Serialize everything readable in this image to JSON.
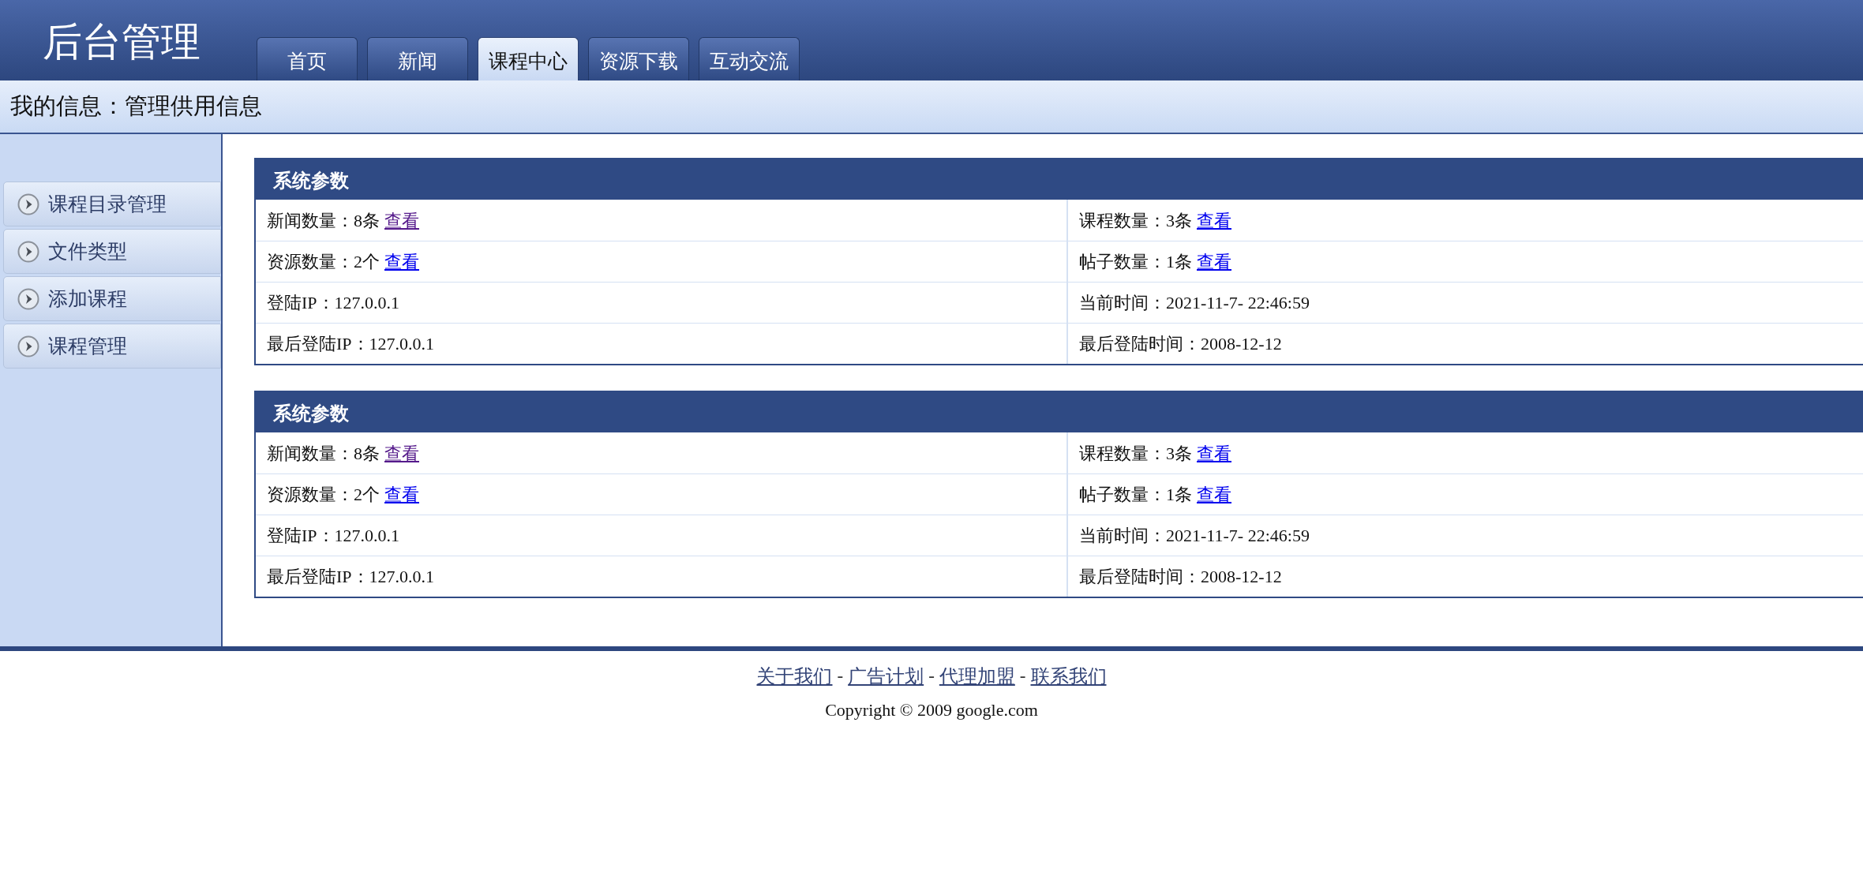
{
  "header": {
    "title": "后台管理",
    "tabs": [
      {
        "label": "首页",
        "selected": false
      },
      {
        "label": "新闻",
        "selected": false
      },
      {
        "label": "课程中心",
        "selected": true
      },
      {
        "label": "资源下载",
        "selected": false
      },
      {
        "label": "互动交流",
        "selected": false
      }
    ]
  },
  "info_bar": {
    "text": "我的信息：管理供用信息"
  },
  "sidebar": {
    "items": [
      {
        "label": "课程目录管理"
      },
      {
        "label": "文件类型"
      },
      {
        "label": "添加课程"
      },
      {
        "label": "课程管理"
      }
    ]
  },
  "panels": [
    {
      "title": "系统参数",
      "rows": [
        [
          {
            "text": "新闻数量：8条",
            "link": {
              "text": "查看",
              "visited": true
            }
          },
          {
            "text": "课程数量：3条",
            "link": {
              "text": "查看",
              "visited": false
            }
          }
        ],
        [
          {
            "text": "资源数量：2个",
            "link": {
              "text": "查看",
              "visited": false
            }
          },
          {
            "text": "帖子数量：1条",
            "link": {
              "text": "查看",
              "visited": false
            }
          }
        ],
        [
          {
            "text": "登陆IP：127.0.0.1"
          },
          {
            "text": "当前时间：2021-11-7- 22:46:59"
          }
        ],
        [
          {
            "text": "最后登陆IP：127.0.0.1"
          },
          {
            "text": "最后登陆时间：2008-12-12"
          }
        ]
      ]
    },
    {
      "title": "系统参数",
      "rows": [
        [
          {
            "text": "新闻数量：8条",
            "link": {
              "text": "查看",
              "visited": true
            }
          },
          {
            "text": "课程数量：3条",
            "link": {
              "text": "查看",
              "visited": false
            }
          }
        ],
        [
          {
            "text": "资源数量：2个",
            "link": {
              "text": "查看",
              "visited": false
            }
          },
          {
            "text": "帖子数量：1条",
            "link": {
              "text": "查看",
              "visited": false
            }
          }
        ],
        [
          {
            "text": "登陆IP：127.0.0.1"
          },
          {
            "text": "当前时间：2021-11-7- 22:46:59"
          }
        ],
        [
          {
            "text": "最后登陆IP：127.0.0.1"
          },
          {
            "text": "最后登陆时间：2008-12-12"
          }
        ]
      ]
    }
  ],
  "footer": {
    "links": [
      "关于我们",
      "广告计划",
      "代理加盟",
      "联系我们"
    ],
    "separator": "-",
    "copyright": "Copyright © 2009 google.com"
  }
}
